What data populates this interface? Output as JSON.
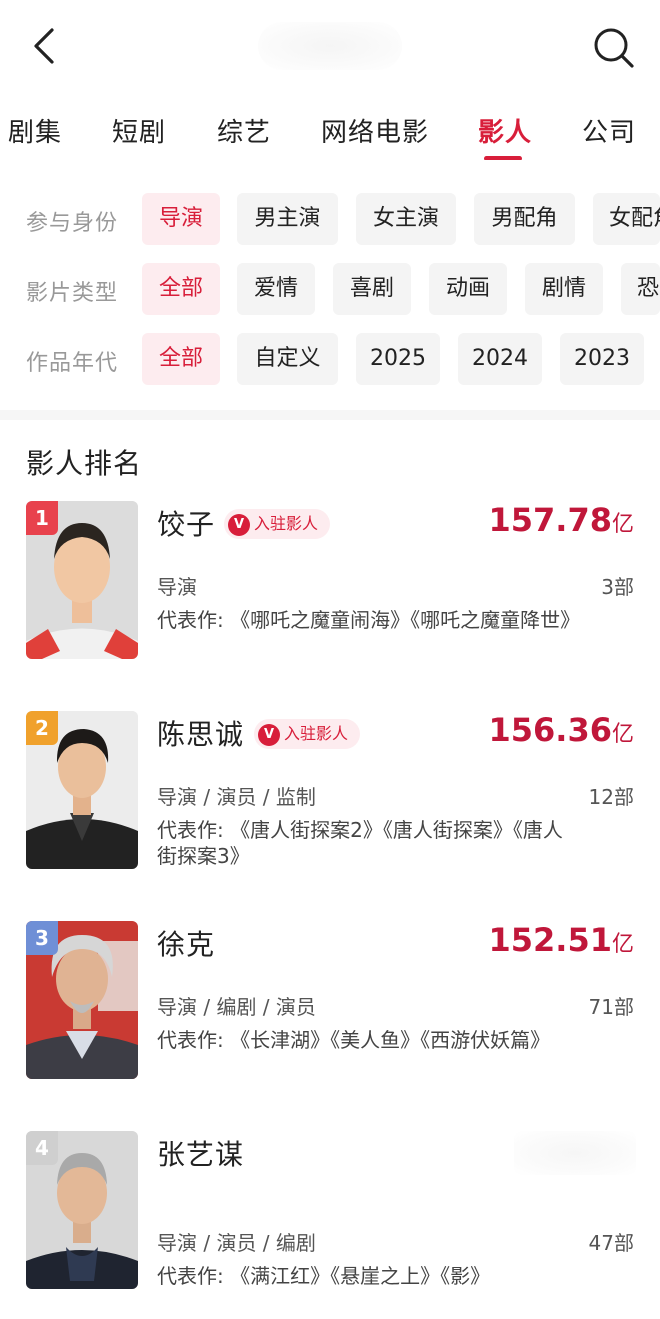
{
  "header": {
    "back_icon": "chevron-left-icon",
    "search_icon": "search-icon"
  },
  "tabs": [
    {
      "label": "剧集",
      "active": false
    },
    {
      "label": "短剧",
      "active": false
    },
    {
      "label": "综艺",
      "active": false
    },
    {
      "label": "网络电影",
      "active": false
    },
    {
      "label": "影人",
      "active": true
    },
    {
      "label": "公司",
      "active": false
    }
  ],
  "filters": [
    {
      "label": "参与身份",
      "options": [
        "导演",
        "男主演",
        "女主演",
        "男配角",
        "女配角"
      ],
      "selected": "导演"
    },
    {
      "label": "影片类型",
      "options": [
        "全部",
        "爱情",
        "喜剧",
        "动画",
        "剧情",
        "恐怖"
      ],
      "selected": "全部"
    },
    {
      "label": "作品年代",
      "options": [
        "全部",
        "自定义",
        "2025",
        "2024",
        "2023"
      ],
      "selected": "全部"
    }
  ],
  "section_title": "影人排名",
  "badge_label": "入驻影人",
  "badge_v": "V",
  "people": [
    {
      "rank": "1",
      "name": "饺子",
      "verified": true,
      "box_office": "157.78",
      "unit": "亿",
      "roles": "导演",
      "count": "3部",
      "works": "代表作: 《哪吒之魔童闹海》《哪吒之魔童降世》"
    },
    {
      "rank": "2",
      "name": "陈思诚",
      "verified": true,
      "box_office": "156.36",
      "unit": "亿",
      "roles": "导演 / 演员 / 监制",
      "count": "12部",
      "works": "代表作: 《唐人街探案2》《唐人街探案》《唐人街探案3》"
    },
    {
      "rank": "3",
      "name": "徐克",
      "verified": false,
      "box_office": "152.51",
      "unit": "亿",
      "roles": "导演 / 编剧 / 演员",
      "count": "71部",
      "works": "代表作: 《长津湖》《美人鱼》《西游伏妖篇》"
    },
    {
      "rank": "4",
      "name": "张艺谋",
      "verified": false,
      "box_office": "",
      "unit": "",
      "roles": "导演 / 演员 / 编剧",
      "count": "47部",
      "works": "代表作: 《满江红》《悬崖之上》《影》"
    }
  ],
  "colors": {
    "accent": "#d81e3a",
    "rank1": "#e8424d",
    "rank2": "#f0a12c",
    "rank3": "#6f8fd6",
    "rank4": "#cfcfcf"
  }
}
